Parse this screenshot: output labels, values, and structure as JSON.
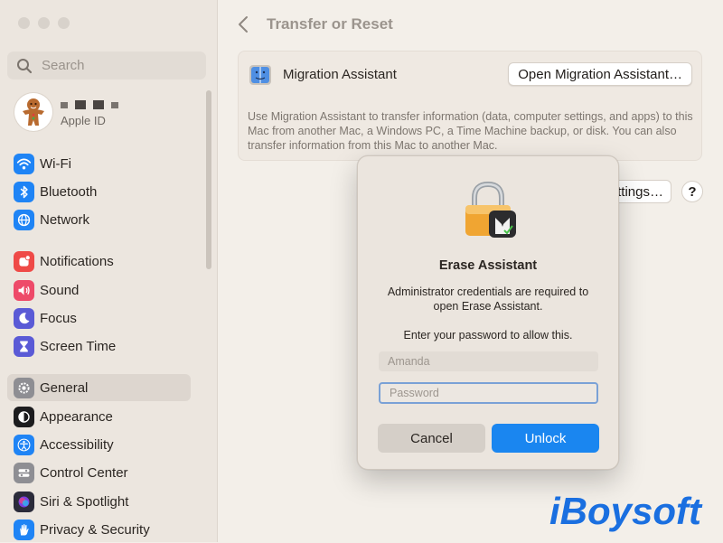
{
  "sidebar": {
    "search_placeholder": "Search",
    "apple_id_label": "Apple ID",
    "items": [
      {
        "label": "Wi-Fi",
        "icon": "wifi-icon",
        "color": "#1f84f5"
      },
      {
        "label": "Bluetooth",
        "icon": "bluetooth-icon",
        "color": "#1f84f5"
      },
      {
        "label": "Network",
        "icon": "globe-icon",
        "color": "#1f84f5"
      },
      {
        "label": "Notifications",
        "icon": "bell-icon",
        "color": "#ef4a47"
      },
      {
        "label": "Sound",
        "icon": "speaker-icon",
        "color": "#ee4a69"
      },
      {
        "label": "Focus",
        "icon": "moon-icon",
        "color": "#5a5ad6"
      },
      {
        "label": "Screen Time",
        "icon": "hourglass-icon",
        "color": "#5a5ad6"
      },
      {
        "label": "General",
        "icon": "gear-icon",
        "color": "#8e8e93",
        "selected": true
      },
      {
        "label": "Appearance",
        "icon": "appearance-icon",
        "color": "#1c1c1e"
      },
      {
        "label": "Accessibility",
        "icon": "accessibility-icon",
        "color": "#1f84f5"
      },
      {
        "label": "Control Center",
        "icon": "control-center-icon",
        "color": "#8e8e93"
      },
      {
        "label": "Siri & Spotlight",
        "icon": "siri-icon",
        "color": "#2b2b3a"
      },
      {
        "label": "Privacy & Security",
        "icon": "hand-icon",
        "color": "#1f84f5"
      }
    ]
  },
  "main": {
    "title": "Transfer or Reset",
    "migration": {
      "label": "Migration Assistant",
      "button": "Open Migration Assistant…",
      "description": "Use Migration Assistant to transfer information (data, computer settings, and apps) to this Mac from another Mac, a Windows PC, a Time Machine backup, or disk. You can also transfer information from this Mac to another Mac."
    },
    "settings_button": "ttings…",
    "help_button": "?"
  },
  "dialog": {
    "title": "Erase Assistant",
    "message": "Administrator credentials are required to open Erase Assistant.",
    "prompt": "Enter your password to allow this.",
    "username_value": "Amanda",
    "password_placeholder": "Password",
    "cancel": "Cancel",
    "unlock": "Unlock"
  },
  "watermark": "iBoysoft",
  "colors": {
    "accent": "#1a86f0",
    "focus_ring": "#7aa1d6",
    "watermark": "#1a6fe0"
  }
}
